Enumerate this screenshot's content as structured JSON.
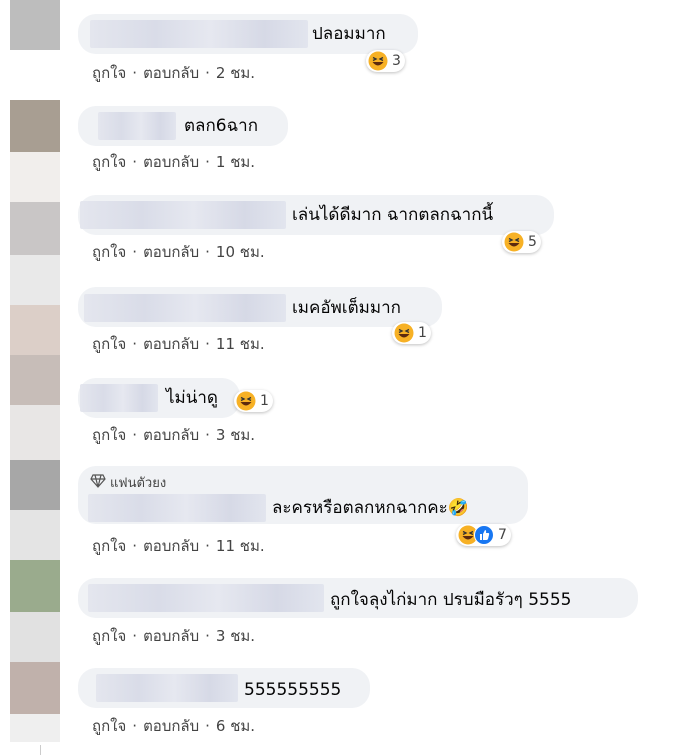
{
  "labels": {
    "like": "ถูกใจ",
    "reply": "ตอบกลับ",
    "sep": "·"
  },
  "fan_badge": "แฟนตัวยง",
  "comments": [
    {
      "text": "ปลอมมาก",
      "time": "2 ชม.",
      "reaction": {
        "emoji": "laugh-emoji-icon",
        "count": "3"
      }
    },
    {
      "text": "ตลก6ฉาก",
      "time": "1 ชม.",
      "reaction": null
    },
    {
      "text": "เล่นได้ดีมาก ฉากตลกฉากนี้",
      "time": "10 ชม.",
      "reaction": {
        "emoji": "laugh-emoji-icon",
        "count": "5"
      }
    },
    {
      "text": "เมคอัพเต็มมาก",
      "time": "11 ชม.",
      "reaction": {
        "emoji": "laugh-emoji-icon",
        "count": "1"
      }
    },
    {
      "text": "ไม่น่าดู",
      "time": "3 ชม.",
      "reaction": {
        "emoji": "laugh-emoji-icon",
        "count": "1"
      }
    },
    {
      "text": "ละครหรือตลกหกฉากคะ🤣",
      "time": "11 ชม.",
      "reaction": {
        "emoji": "laugh-emoji-icon",
        "count": "7"
      }
    },
    {
      "text": "ถูกใจลุงไก่มาก ปรบมือรัวๆ 5555",
      "time": "3 ชม.",
      "reaction": null
    },
    {
      "text": "555555555",
      "time": "6 ชม.",
      "reaction": null
    }
  ],
  "colors": {
    "bubble": "#f0f2f5",
    "like_blue": "#1877f2",
    "haha_yellow": "#f7b125"
  }
}
